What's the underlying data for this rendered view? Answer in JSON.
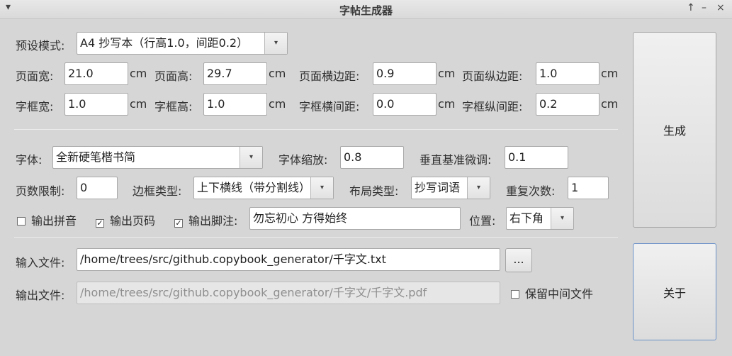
{
  "window": {
    "title": "字帖生成器",
    "controls": {
      "up": "↑",
      "minimize": "–",
      "close": "×"
    },
    "menu_glyph": "▾"
  },
  "preset": {
    "label": "预设模式:",
    "value": "A4 抄写本（行高1.0，间距0.2）"
  },
  "page": {
    "width_label": "页面宽:",
    "width": "21.0",
    "height_label": "页面高:",
    "height": "29.7",
    "hmargin_label": "页面横边距:",
    "hmargin": "0.9",
    "vmargin_label": "页面纵边距:",
    "vmargin": "1.0"
  },
  "box": {
    "width_label": "字框宽:",
    "width": "1.0",
    "height_label": "字框高:",
    "height": "1.0",
    "hgap_label": "字框横间距:",
    "hgap": "0.0",
    "vgap_label": "字框纵间距:",
    "vgap": "0.2"
  },
  "unit": "cm",
  "font": {
    "label": "字体:",
    "value": "全新硬笔楷书简",
    "scale_label": "字体缩放:",
    "scale": "0.8",
    "baseline_label": "垂直基准微调:",
    "baseline": "0.1"
  },
  "options": {
    "page_limit_label": "页数限制:",
    "page_limit": "0",
    "border_label": "边框类型:",
    "border": "上下横线（带分割线）",
    "layout_label": "布局类型:",
    "layout": "抄写词语",
    "repeat_label": "重复次数:",
    "repeat": "1"
  },
  "checks": {
    "pinyin_label": "输出拼音",
    "pinyin_checked": false,
    "pageno_label": "输出页码",
    "pageno_checked": true,
    "footer_label": "输出脚注:",
    "footer_checked": true,
    "footer_text": "勿忘初心 方得始终",
    "position_label": "位置:",
    "position": "右下角"
  },
  "files": {
    "input_label": "输入文件:",
    "input": "/home/trees/src/github.copybook_generator/千字文.txt",
    "browse": "...",
    "output_label": "输出文件:",
    "output": "/home/trees/src/github.copybook_generator/千字文/千字文.pdf",
    "keep_label": "保留中间文件",
    "keep_checked": false
  },
  "buttons": {
    "generate": "生成",
    "about": "关于"
  },
  "glyphs": {
    "arrow": "▾",
    "check": "✓"
  }
}
